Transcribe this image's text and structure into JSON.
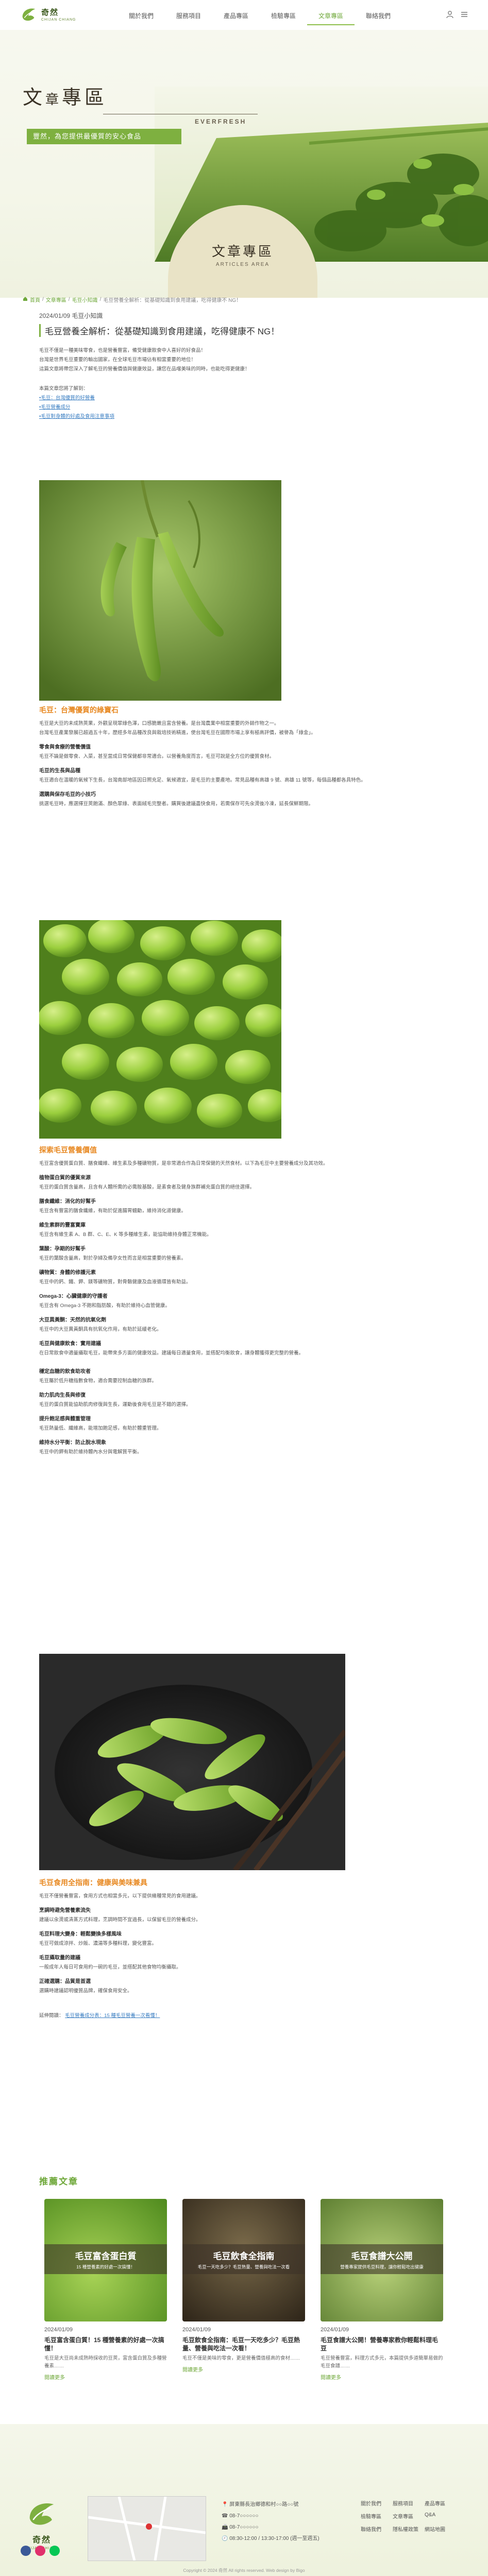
{
  "brand": {
    "name_cn": "奇然",
    "name_en": "CHIJAN CHIANG"
  },
  "nav": [
    "關於我們",
    "服務項目",
    "產品專區",
    "檢驗專區",
    "文章專區",
    "聯絡我們"
  ],
  "banner": {
    "title_big": "文",
    "title_sm": "章",
    "title_rest": "專區",
    "subtitle": "豐然，為您提供最優質的安心食品",
    "ever": "EVERFRESH",
    "arch_title": "文章專區",
    "arch_en": "ARTICLES AREA"
  },
  "crumbs": [
    "首頁",
    "文章專區",
    "毛豆小知識",
    "毛豆營養全解析：從基礎知識到食用建議，吃得健康不 NG！"
  ],
  "article": {
    "meta": "2024/01/09  毛豆小知識",
    "title": "毛豆營養全解析：從基礎知識到食用建議，吃得健康不 NG！",
    "intro": [
      "毛豆不僅是一種美味零食，也是營養豐富，備受健康飲食中人喜好的好食品！",
      "台灣是世界毛豆重要的輸出國家，在全球毛豆市場佔有相當重要的地位！",
      "這篇文章將帶您深入了解毛豆的營養價值與健康效益，讓您在品嚐美味的同時，也能吃得更健康！"
    ],
    "toc_intro": "本篇文章您將了解到：",
    "toc": [
      "•毛豆：台灣優質的好營養",
      "•毛豆營養成分",
      "•毛豆對身體的好處及食用注意事項"
    ],
    "s1_heading": "毛豆：台灣優質的綠寶石",
    "s1": [
      "毛豆是大豆的未成熟莢果，外觀呈現翠綠色澤，口感脆嫩且富含營養。是台灣農業中相當重要的外銷作物之一。",
      "台灣毛豆產業發展已超過五十年，歷經多年品種改良與栽培技術精進，使台灣毛豆在國際市場上享有極高評價，被譽為「綠金」。"
    ],
    "s1_h1": "零食與食療的營養價值",
    "s1_p1": [
      "毛豆不論是做零食、入菜，甚至當成日常保健都非常適合。以營養角度而言，毛豆可說是全方位的優質食材。"
    ],
    "s1_h2": "毛豆的生長與品種",
    "s1_p2": [
      "毛豆適合在溫暖的氣候下生長，台灣南部地區因日照充足、氣候適宜，是毛豆的主要產地。常見品種有高雄 9 號、高雄 11 號等，每個品種都各具特色。"
    ],
    "s1_h3": "選購與保存毛豆的小技巧",
    "s1_p3": [
      "挑選毛豆時，應選擇豆莢飽滿、顏色翠綠、表面絨毛完整者。購買後建議盡快食用，若需保存可先汆燙後冷凍，延長保鮮期限。"
    ],
    "s2_heading": "探索毛豆營養價值",
    "s2": [
      "毛豆富含優質蛋白質、膳食纖維、維生素及多種礦物質，是非常適合作為日常保健的天然食材。以下為毛豆中主要營養成分及其功效。"
    ],
    "s2_h1": "植物蛋白質的優質來源",
    "s2_p1": [
      "毛豆的蛋白質含量高，且含有人體所需的必需胺基酸，是素食者及健身族群補充蛋白質的絕佳選擇。"
    ],
    "s2_h2": "膳食纖維：消化的好幫手",
    "s2_p2": [
      "毛豆含有豐富的膳食纖維，有助於促進腸胃蠕動，維持消化道健康。"
    ],
    "s2_h3": "維生素群的豐富寶庫",
    "s2_p3": [
      "毛豆含有維生素 A、B 群、C、E、K 等多種維生素，能協助維持身體正常機能。"
    ],
    "s2_h4": "葉酸：孕期的好幫手",
    "s2_p4": [
      "毛豆的葉酸含量高，對於孕婦及備孕女性而言是相當重要的營養素。"
    ],
    "s2_h5": "礦物質：身體的修護元素",
    "s2_p5": [
      "毛豆中的鈣、鐵、鉀、鎂等礦物質，對骨骼健康及血液循環皆有助益。"
    ],
    "s2_h6": "Omega-3：心臟健康的守護者",
    "s2_p6": [
      "毛豆含有 Omega-3 不飽和脂肪酸，有助於維持心血管健康。"
    ],
    "s2_h7": "大豆異黃酮：天然的抗氧化劑",
    "s2_p7": [
      "毛豆中的大豆異黃酮具有抗氧化作用，有助於延緩老化。"
    ],
    "s2_h8": "毛豆與健康飲食：實用建議",
    "s2_p8": [
      "在日常飲食中適量攝取毛豆，能帶來多方面的健康效益。建議每日適量食用，並搭配均衡飲食，讓身體獲得更完整的營養。"
    ],
    "s3_h1": "穩定血糖的飲食助攻者",
    "s3_p1": [
      "毛豆屬於低升糖指數食物，適合需要控制血糖的族群。"
    ],
    "s3_h2": "助力肌肉生長與修復",
    "s3_p2": [
      "毛豆的蛋白質能協助肌肉修復與生長，運動後食用毛豆是不錯的選擇。"
    ],
    "s3_h3": "提升飽足感與體重管理",
    "s3_p3": [
      "毛豆熱量低、纖維高，能增加飽足感，有助於體重管理。"
    ],
    "s3_h4": "維持水分平衡：防止脫水現象",
    "s3_p4": [
      "毛豆中的鉀有助於維持體內水分與電解質平衡。"
    ],
    "s4_heading": "毛豆食用全指南：健康與美味兼具",
    "s4": [
      "毛豆不僅營養豐富，食用方式也相當多元，以下提供幾種常見的食用建議。"
    ],
    "s4_h1": "烹調時避免營養素流失",
    "s4_p1": [
      "建議以汆燙或清蒸方式料理，烹調時間不宜過長，以保留毛豆的營養成分。"
    ],
    "s4_h2": "毛豆料理大變身：輕鬆變換多樣風味",
    "s4_p2": [
      "毛豆可做成涼拌、炒飯、濃湯等多種料理，變化豐富。"
    ],
    "s4_h3": "毛豆攝取量的建議",
    "s4_p3": [
      "一般成年人每日可食用約一碗的毛豆，並搭配其他食物均衡攝取。"
    ],
    "s4_h4": "正確選購：品質是首選",
    "s4_p4": [
      "選購時建議認明優質品牌，確保食用安全。"
    ],
    "more_label": "延伸閱讀：",
    "more_link": "毛豆營養成分表：15 種毛豆營養一次看懂！"
  },
  "related": {
    "heading": "推薦文章",
    "cards": [
      {
        "band_title": "毛豆富含蛋白質",
        "band_sub": "15 種營養素的好處一次搞懂！",
        "date": "2024/01/09",
        "title": "毛豆富含蛋白質！15 種營養素的好處一次搞懂！",
        "desc": "毛豆是大豆尚未成熟時採收的豆莢，富含蛋白質及多種營養素……",
        "more": "閱讀更多"
      },
      {
        "band_title": "毛豆飲食全指南",
        "band_sub": "毛豆一天吃多少？毛豆熱量、營養與吃法一次看",
        "date": "2024/01/09",
        "title": "毛豆飲食全指南：毛豆一天吃多少？毛豆熱量、營養與吃法一次看！",
        "desc": "毛豆不僅是美味的零食，更是營養價值極高的食材……",
        "more": "閱讀更多"
      },
      {
        "band_title": "毛豆食譜大公開",
        "band_sub": "營養專家提供毛豆料理，讓你輕鬆吃出健康",
        "date": "2024/01/09",
        "title": "毛豆食譜大公開！營養專家教你輕鬆料理毛豆",
        "desc": "毛豆營養豐富，料理方式多元，本篇提供多道簡單易做的毛豆食譜……",
        "more": "閱讀更多"
      }
    ]
  },
  "footer": {
    "address": "屏東縣長治鄉德和村○○路○○號",
    "phone": "08-7○○○○○○",
    "fax": "08-7○○○○○○",
    "hours": "08:30-12:00 / 13:30-17:00 (週一至週五)",
    "links": [
      "關於我們",
      "服務項目",
      "產品專區",
      "檢驗專區",
      "文章專區",
      "Q&A",
      "聯絡我們",
      "隱私權政策",
      "網站地圖"
    ],
    "copyright": "Copyright © 2024 奇然 All rights reserved. Web design by Bigo"
  },
  "colors": {
    "accent": "#7eb040",
    "orange": "#e88a24",
    "dark": "#3b3326"
  }
}
